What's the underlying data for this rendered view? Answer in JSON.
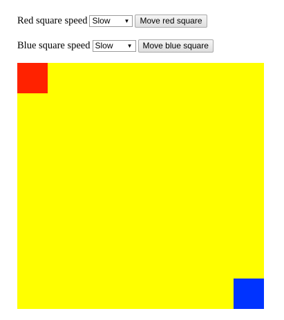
{
  "controls": {
    "red": {
      "label": "Red square speed",
      "speed_value": "Slow",
      "button_label": "Move red square"
    },
    "blue": {
      "label": "Blue square speed",
      "speed_value": "Slow",
      "button_label": "Move blue square"
    }
  },
  "icons": {
    "dropdown_caret": "▼"
  },
  "colors": {
    "arena": "#ffff00",
    "red_square": "#ff2200",
    "blue_square": "#0033ff"
  }
}
